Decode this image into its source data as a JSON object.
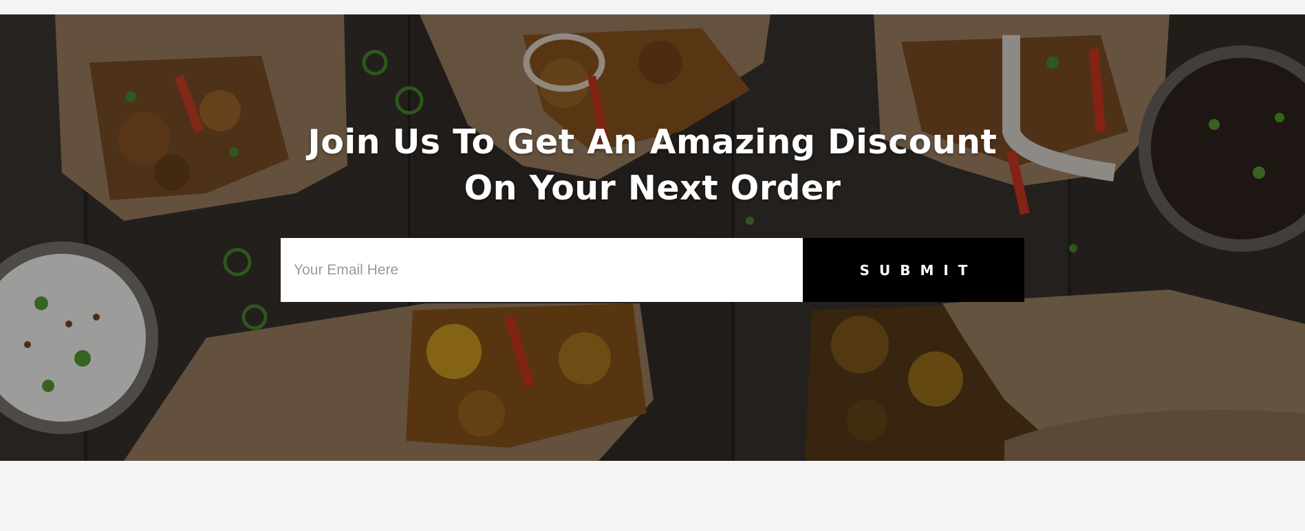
{
  "newsletter": {
    "headline_line1": "Join Us To Get An Amazing Discount",
    "headline_line2": "On Your Next Order",
    "email_placeholder": "Your Email Here",
    "email_value": "",
    "submit_label": "SUBMIT"
  },
  "colors": {
    "page_background": "#f4f4f4",
    "headline_text": "#ffffff",
    "submit_background": "#000000",
    "submit_text": "#ffffff",
    "input_background": "#ffffff",
    "placeholder_text": "#9a9a9a"
  }
}
